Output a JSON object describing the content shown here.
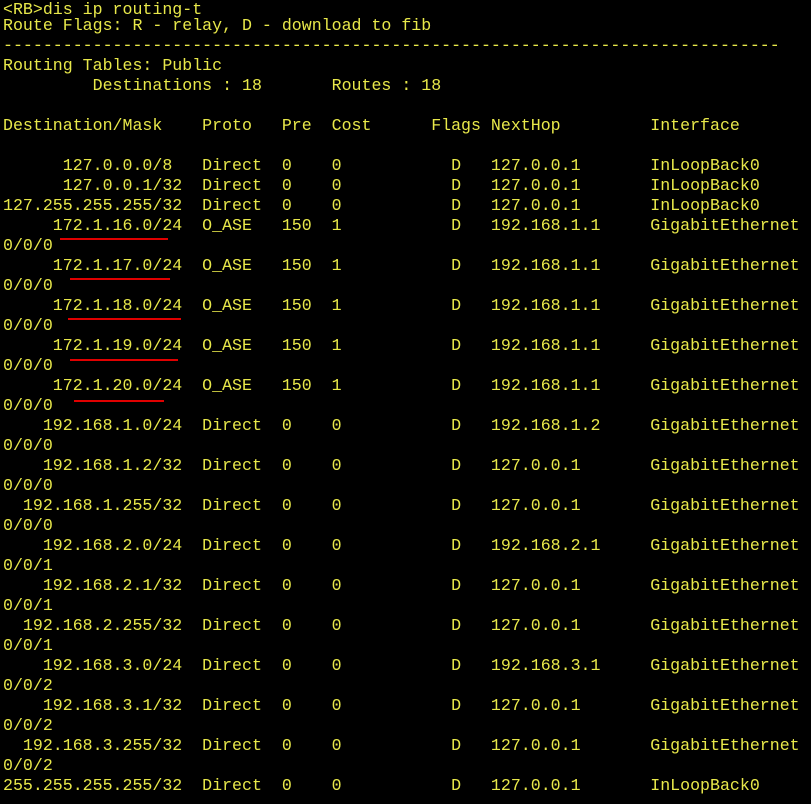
{
  "terminal": {
    "text_color": "#e8e84a",
    "background": "#000000",
    "highlight_color": "#e00000",
    "lines": [
      "<RB>dis ip routing-t",
      "Route Flags: R - relay, D - download to fib",
      "------------------------------------------------------------------------------",
      "Routing Tables: Public",
      "         Destinations : 18       Routes : 18",
      "",
      "Destination/Mask    Proto   Pre  Cost      Flags NextHop         Interface",
      "",
      "      127.0.0.0/8   Direct  0    0           D   127.0.0.1       InLoopBack0",
      "      127.0.0.1/32  Direct  0    0           D   127.0.0.1       InLoopBack0",
      "127.255.255.255/32  Direct  0    0           D   127.0.0.1       InLoopBack0",
      "     172.1.16.0/24  O_ASE   150  1           D   192.168.1.1     GigabitEthernet",
      "0/0/0",
      "     172.1.17.0/24  O_ASE   150  1           D   192.168.1.1     GigabitEthernet",
      "0/0/0",
      "     172.1.18.0/24  O_ASE   150  1           D   192.168.1.1     GigabitEthernet",
      "0/0/0",
      "     172.1.19.0/24  O_ASE   150  1           D   192.168.1.1     GigabitEthernet",
      "0/0/0",
      "     172.1.20.0/24  O_ASE   150  1           D   192.168.1.1     GigabitEthernet",
      "0/0/0",
      "    192.168.1.0/24  Direct  0    0           D   192.168.1.2     GigabitEthernet",
      "0/0/0",
      "    192.168.1.2/32  Direct  0    0           D   127.0.0.1       GigabitEthernet",
      "0/0/0",
      "  192.168.1.255/32  Direct  0    0           D   127.0.0.1       GigabitEthernet",
      "0/0/0",
      "    192.168.2.0/24  Direct  0    0           D   192.168.2.1     GigabitEthernet",
      "0/0/1",
      "    192.168.2.1/32  Direct  0    0           D   127.0.0.1       GigabitEthernet",
      "0/0/1",
      "  192.168.2.255/32  Direct  0    0           D   127.0.0.1       GigabitEthernet",
      "0/0/1",
      "    192.168.3.0/24  Direct  0    0           D   192.168.3.1     GigabitEthernet",
      "0/0/2",
      "    192.168.3.1/32  Direct  0    0           D   127.0.0.1       GigabitEthernet",
      "0/0/2",
      "  192.168.3.255/32  Direct  0    0           D   127.0.0.1       GigabitEthernet",
      "0/0/2",
      "255.255.255.255/32  Direct  0    0           D   127.0.0.1       InLoopBack0"
    ]
  }
}
